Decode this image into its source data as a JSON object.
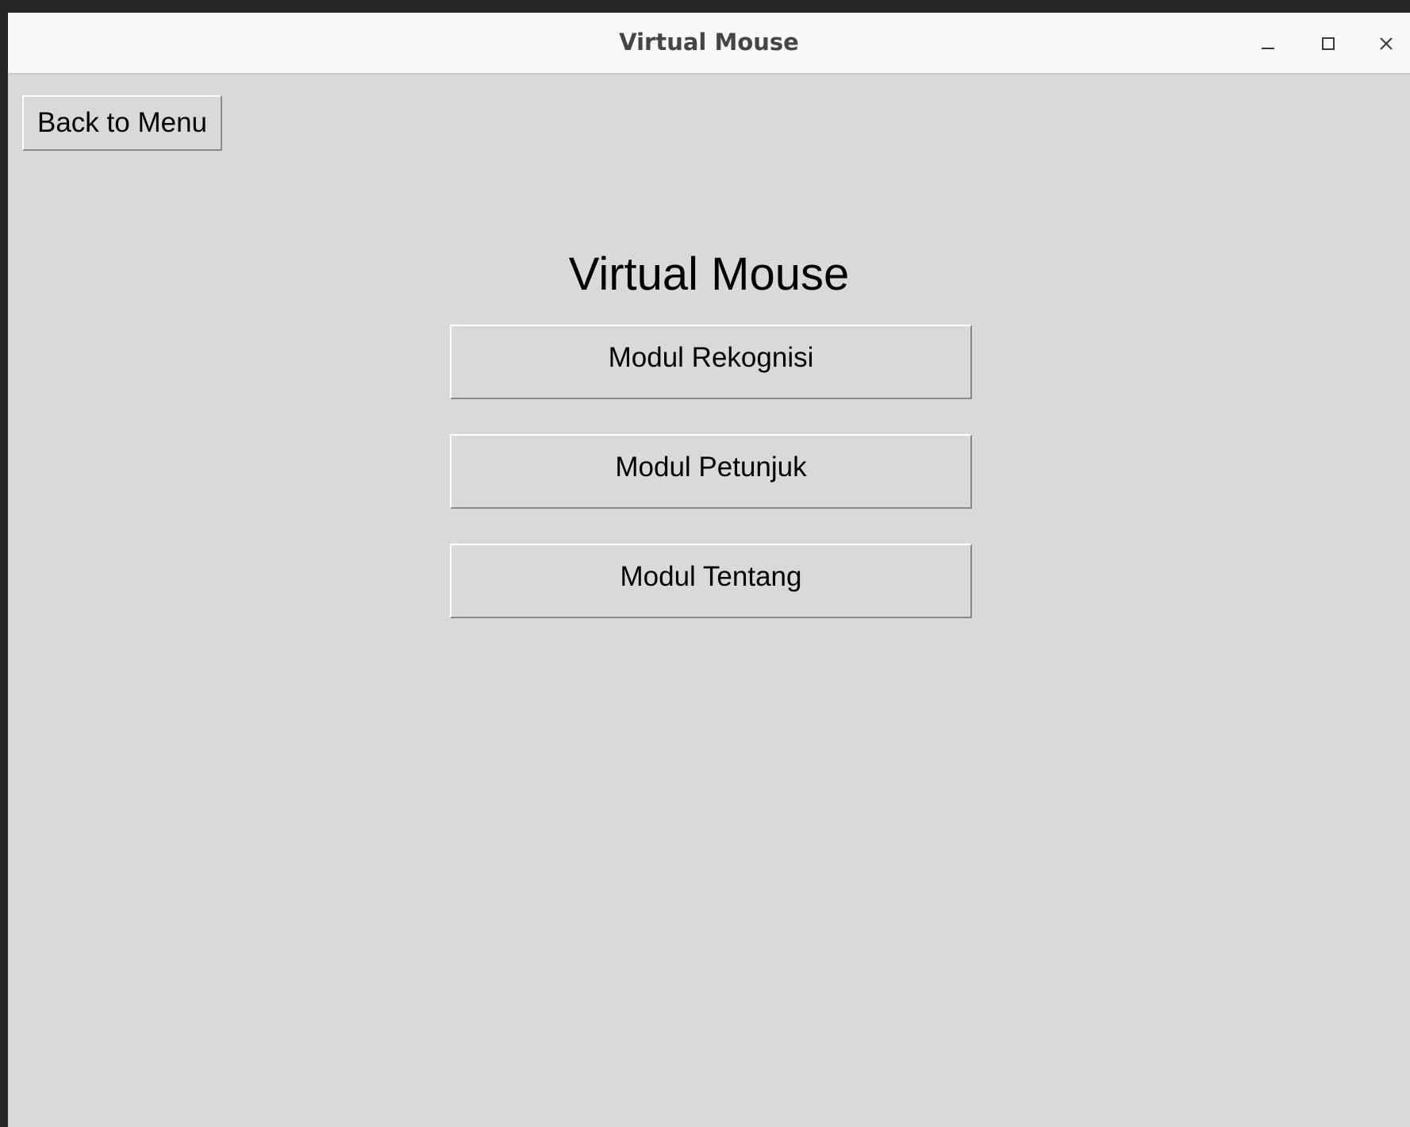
{
  "window": {
    "title": "Virtual Mouse",
    "controls": {
      "minimize_icon": "minimize-icon",
      "maximize_icon": "maximize-icon",
      "close_icon": "close-icon"
    }
  },
  "toolbar": {
    "back_label": "Back to Menu"
  },
  "main": {
    "heading": "Virtual Mouse",
    "modules": [
      {
        "label": "Modul Rekognisi"
      },
      {
        "label": "Modul Petunjuk"
      },
      {
        "label": "Modul Tentang"
      }
    ]
  },
  "colors": {
    "background": "#d9d9d9",
    "titlebar": "#f9f9f9",
    "desktop": "#272727"
  }
}
